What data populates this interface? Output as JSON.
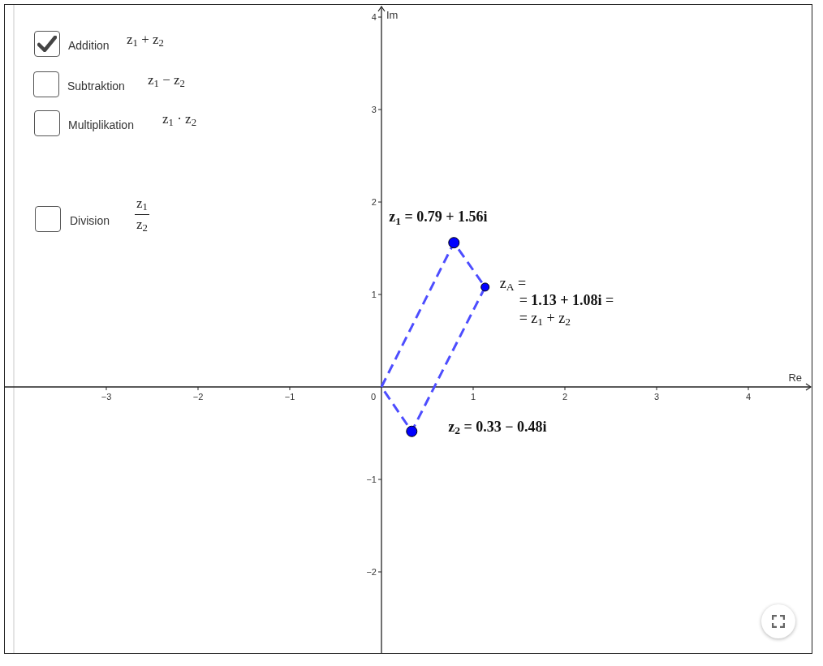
{
  "operations": [
    {
      "label": "Addition",
      "checked": true,
      "kind": "inline",
      "formula": "z$_{1}$ + z$_{2}$"
    },
    {
      "label": "Subtraktion",
      "checked": false,
      "kind": "inline",
      "formula": "z$_{1}$ − z$_{2}$"
    },
    {
      "label": "Multiplikation",
      "checked": false,
      "kind": "inline",
      "formula": "z$_{1}$ · z$_{2}$"
    },
    {
      "label": "Division",
      "checked": false,
      "kind": "fraction",
      "numerator": "z$_{1}$",
      "denominator": "z$_{2}$"
    }
  ],
  "graph": {
    "chart_data": {
      "type": "scatter",
      "xlabel": "Re",
      "ylabel": "Im",
      "x": [
        0.79,
        0.33,
        1.13
      ],
      "series": [
        {
          "color": "#0000ff",
          "values": [
            1.56,
            -0.48,
            null
          ]
        },
        {
          "color": "#0000ff",
          "values": [
            null,
            null,
            1.08
          ]
        }
      ],
      "xlim": [
        -4.106,
        4.699
      ],
      "ylim": [
        -2.886,
        4.132
      ],
      "xticks": [
        {
          "value": -3,
          "label": "−3"
        },
        {
          "value": -2,
          "label": "−2"
        },
        {
          "value": -1,
          "label": "−1"
        },
        {
          "value": 1,
          "label": "1"
        },
        {
          "value": 2,
          "label": "2"
        },
        {
          "value": 3,
          "label": "3"
        },
        {
          "value": 4,
          "label": "4"
        }
      ],
      "yticks": [
        {
          "value": -2,
          "label": "−2"
        },
        {
          "value": -1,
          "label": "−1"
        },
        {
          "value": 1,
          "label": "1"
        },
        {
          "value": 2,
          "label": "2"
        },
        {
          "value": 3,
          "label": "3"
        },
        {
          "value": 4,
          "label": "4"
        }
      ]
    },
    "origin_label": "0",
    "point_labels": [
      {
        "kind": "free",
        "lines": [
          "z$_{1}$ = 0.79 + 1.56i"
        ]
      },
      {
        "kind": "free",
        "lines": [
          "z$_{2}$ = 0.33 − 0.48i"
        ]
      },
      {
        "kind": "derived",
        "lines": [
          "z$_{A}$ =",
          "= **1.13 + 1.08i** =",
          "= z$_{1}$ + z$_{2}$"
        ]
      }
    ]
  }
}
